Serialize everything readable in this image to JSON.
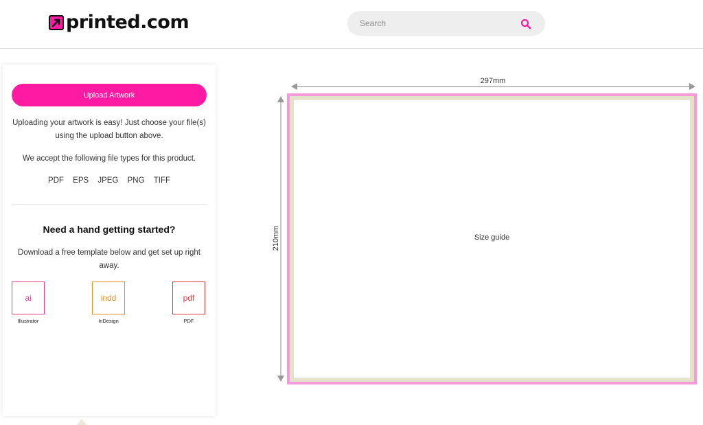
{
  "header": {
    "logo_text": "printed.com",
    "search": {
      "placeholder": "Search",
      "icon": "search-icon"
    }
  },
  "sidebar": {
    "upload_label": "Upload Artwork",
    "intro": "Uploading your artwork is easy! Just choose your file(s) using the upload button above.",
    "accept": "We accept the following file types for this product.",
    "file_types": [
      "PDF",
      "EPS",
      "JPEG",
      "PNG",
      "TIFF"
    ],
    "help_title": "Need a hand getting started?",
    "help_text": "Download a free template below and get set up right away.",
    "templates": [
      {
        "icon_text": "ai",
        "label": "Illustrator",
        "color": "#e8348c"
      },
      {
        "icon_text": "indd",
        "label": "InDesign",
        "color": "#f08a1c"
      },
      {
        "icon_text": "pdf",
        "label": "PDF",
        "color": "#e03a3a"
      }
    ]
  },
  "size_guide": {
    "width_label": "297mm",
    "height_label": "210mm",
    "center_label": "Size guide"
  },
  "colors": {
    "brand": "#ff1aa3",
    "bleed": "#f59ad8",
    "trim": "#e6e1cc"
  }
}
